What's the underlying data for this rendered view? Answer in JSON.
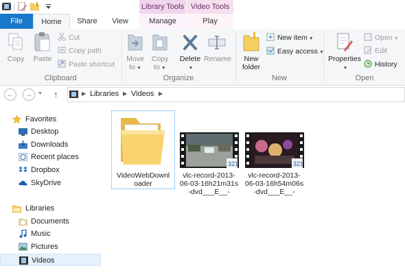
{
  "context_tabs": {
    "library_tools": "Library Tools",
    "video_tools": "Video Tools"
  },
  "tabs": {
    "file": "File",
    "home": "Home",
    "share": "Share",
    "view": "View",
    "manage": "Manage",
    "play": "Play"
  },
  "ribbon": {
    "clipboard": {
      "label": "Clipboard",
      "copy": "Copy",
      "paste": "Paste",
      "cut": "Cut",
      "copy_path": "Copy path",
      "paste_shortcut": "Paste shortcut"
    },
    "organize": {
      "label": "Organize",
      "move_to": "Move",
      "move_to_sub": "to",
      "copy_to": "Copy",
      "copy_to_sub": "to",
      "delete": "Delete",
      "rename": "Rename"
    },
    "new": {
      "label": "New",
      "new_folder": "New",
      "new_folder_sub": "folder",
      "new_item": "New item",
      "easy_access": "Easy access"
    },
    "open": {
      "label": "Open",
      "properties": "Properties",
      "open": "Open",
      "edit": "Edit",
      "history": "History"
    }
  },
  "address": {
    "crumbs": [
      "Libraries",
      "Videos"
    ]
  },
  "nav": {
    "favorites": "Favorites",
    "favorites_items": [
      "Desktop",
      "Downloads",
      "Recent places",
      "Dropbox",
      "SkyDrive"
    ],
    "libraries": "Libraries",
    "libraries_items": [
      "Documents",
      "Music",
      "Pictures",
      "Videos"
    ]
  },
  "files": [
    {
      "type": "folder",
      "name": "VideoWebDownloader",
      "lines": [
        "VideoWebDownl",
        "oader"
      ]
    },
    {
      "type": "video",
      "name": "vlc-record-2013-06-03-16h21m31s-dvd___E__-",
      "lines": [
        "vlc-record-2013-",
        "06-03-16h21m31s",
        "-dvd___E__-"
      ]
    },
    {
      "type": "video",
      "name": "vlc-record-2013-06-03-16h54m06s-dvd___E__-",
      "lines": [
        "vlc-record-2013-",
        "06-03-16h54m06s",
        "-dvd___E__-"
      ]
    }
  ],
  "colors": {
    "file_tab": "#1979ca",
    "context_tab": "#f0d5ec",
    "selection": "#e5f1fb",
    "folder": "#f5cf62"
  }
}
